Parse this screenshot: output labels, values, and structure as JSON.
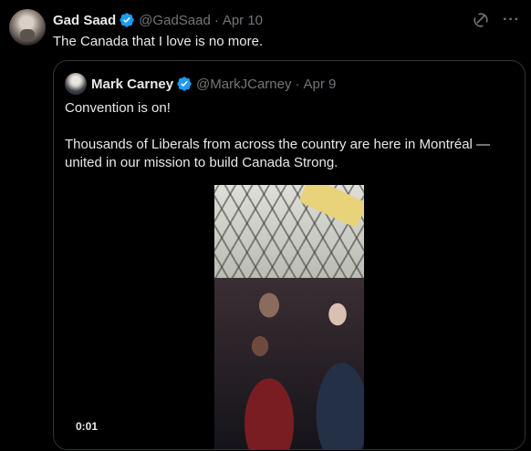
{
  "tweet": {
    "author_name": "Gad Saad",
    "handle": "@GadSaad",
    "separator": "·",
    "date": "Apr 10",
    "text": "The Canada that I love is no more.",
    "more_label": "···"
  },
  "quoted": {
    "author_name": "Mark Carney",
    "handle": "@MarkJCarney",
    "separator": "·",
    "date": "Apr 9",
    "paragraph1": "Convention is on!",
    "paragraph2": "Thousands of Liberals from across the country are here in Montréal — united in our mission to build Canada Strong.",
    "video_time": "0:01"
  },
  "colors": {
    "background": "#000000",
    "text": "#e7e9ea",
    "muted": "#71767b",
    "border": "#2f3336",
    "verified": "#1d9bf0"
  },
  "icons": {
    "verified": "verified-badge-icon",
    "grok": "grok-icon",
    "more": "more-dots-icon"
  }
}
